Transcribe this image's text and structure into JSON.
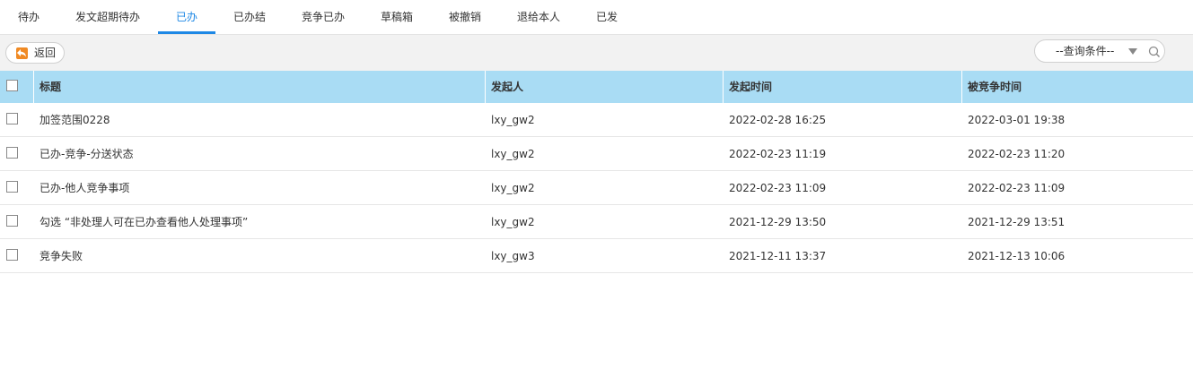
{
  "tabs": [
    {
      "label": "待办"
    },
    {
      "label": "发文超期待办"
    },
    {
      "label": "已办"
    },
    {
      "label": "已办结"
    },
    {
      "label": "竞争已办"
    },
    {
      "label": "草稿箱"
    },
    {
      "label": "被撤销"
    },
    {
      "label": "退给本人"
    },
    {
      "label": "已发"
    }
  ],
  "active_tab": "已办",
  "toolbar": {
    "back_label": "返回",
    "query_label": "--查询条件--"
  },
  "table": {
    "headers": [
      "标题",
      "发起人",
      "发起时间",
      "被竞争时间"
    ],
    "rows": [
      {
        "title": "加签范围0228",
        "initiator": "lxy_gw2",
        "start_time": "2022-02-28 16:25",
        "compete_time": "2022-03-01 19:38"
      },
      {
        "title": "已办-竞争-分送状态",
        "initiator": "lxy_gw2",
        "start_time": "2022-02-23 11:19",
        "compete_time": "2022-02-23 11:20"
      },
      {
        "title": "已办-他人竞争事项",
        "initiator": "lxy_gw2",
        "start_time": "2022-02-23 11:09",
        "compete_time": "2022-02-23 11:09"
      },
      {
        "title": "勾选 “非处理人可在已办查看他人处理事项”",
        "initiator": "lxy_gw2",
        "start_time": "2021-12-29 13:50",
        "compete_time": "2021-12-29 13:51"
      },
      {
        "title": "竞争失败",
        "initiator": "lxy_gw3",
        "start_time": "2021-12-11 13:37",
        "compete_time": "2021-12-13 10:06"
      }
    ]
  },
  "colors": {
    "accent": "#1e88e5",
    "header_bg": "#a9dcf4",
    "toolbar_bg": "#f2f2f2",
    "back_icon": "#f08a24"
  },
  "icons": {
    "back": "back-arrow-icon",
    "caret": "caret-down-icon",
    "search": "search-icon"
  }
}
